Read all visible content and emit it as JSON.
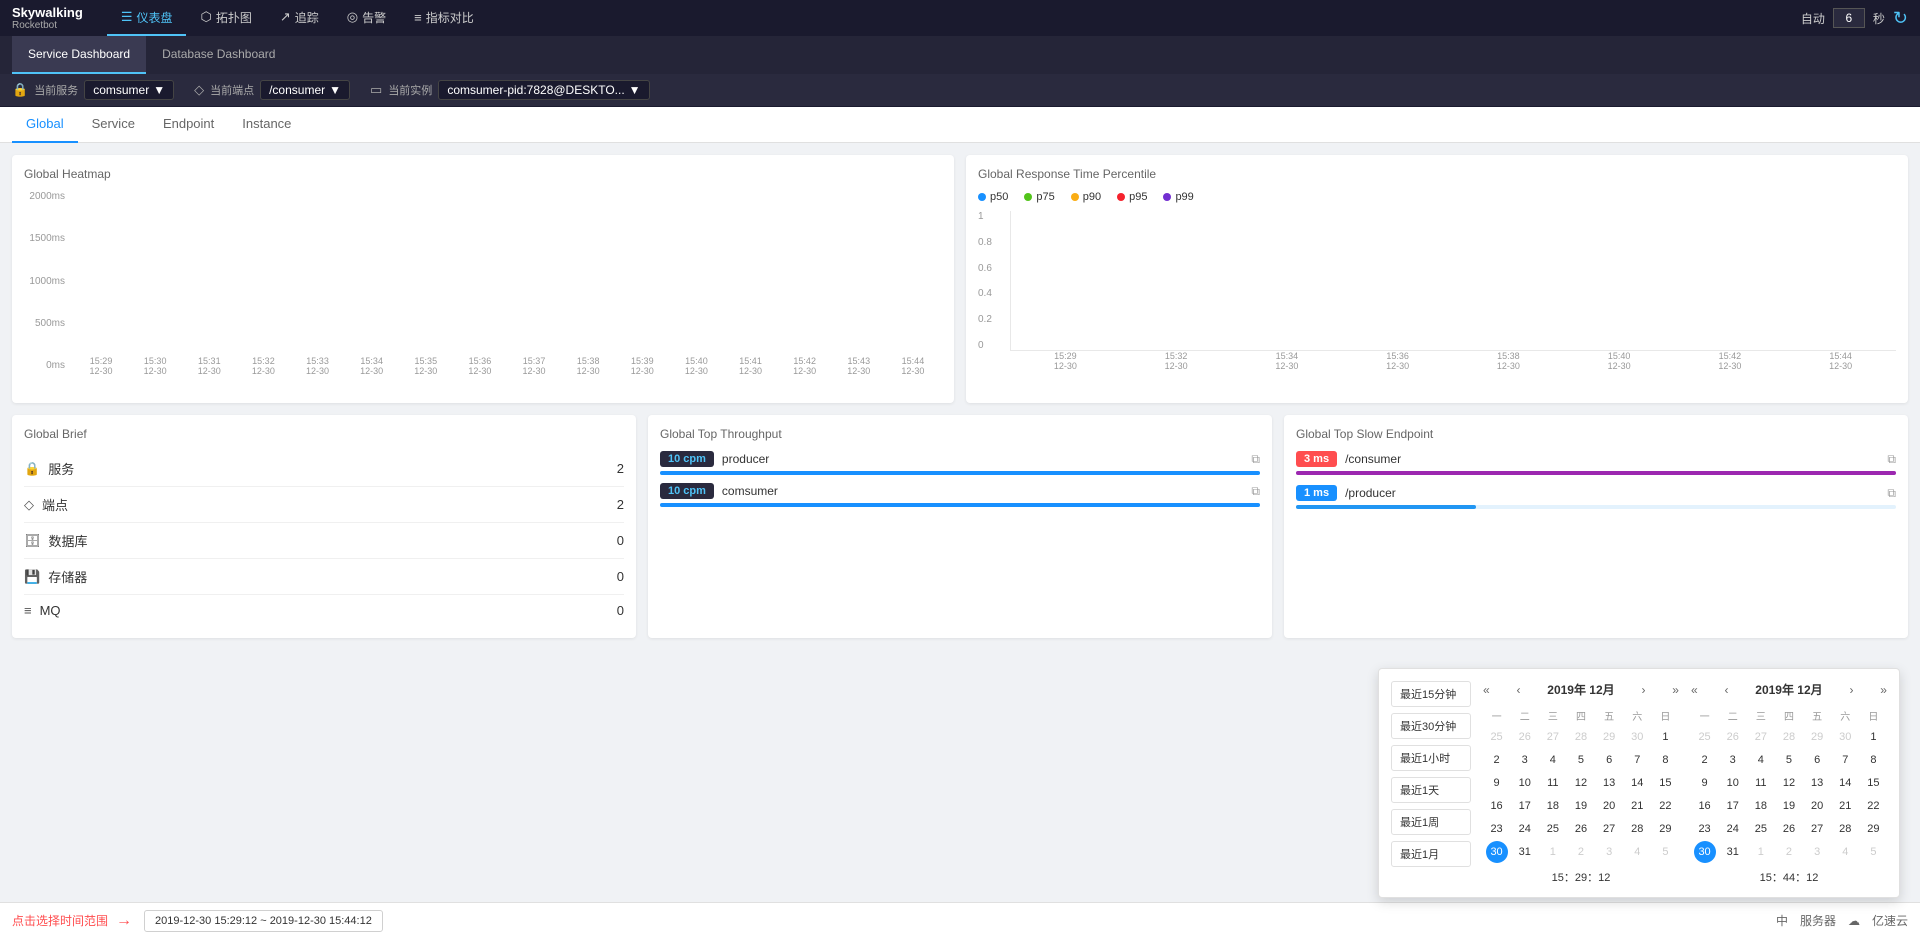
{
  "brand": {
    "name": "Skywalking",
    "sub": "Rocketbot"
  },
  "nav": {
    "items": [
      {
        "id": "dashboard",
        "icon": "☰",
        "label": "仪表盘",
        "active": true
      },
      {
        "id": "topology",
        "icon": "⬡",
        "label": "拓扑图",
        "active": false
      },
      {
        "id": "trace",
        "icon": "↗",
        "label": "追踪",
        "active": false
      },
      {
        "id": "alert",
        "icon": "◎",
        "label": "告警",
        "active": false
      },
      {
        "id": "compare",
        "icon": "≡",
        "label": "指标对比",
        "active": false
      }
    ],
    "auto_label": "自动",
    "sec_value": "6",
    "sec_label": "秒",
    "refresh_label": "刷新"
  },
  "tabs": [
    {
      "id": "service",
      "label": "Service Dashboard",
      "active": true
    },
    {
      "id": "database",
      "label": "Database Dashboard",
      "active": false
    }
  ],
  "toolbar": {
    "service_label": "当前服务",
    "service_value": "comsumer",
    "endpoint_label": "当前端点",
    "endpoint_value": "/consumer",
    "instance_label": "当前实例",
    "instance_value": "comsumer-pid:7828@DESKTO..."
  },
  "content_tabs": [
    {
      "id": "global",
      "label": "Global",
      "active": true
    },
    {
      "id": "service",
      "label": "Service",
      "active": false
    },
    {
      "id": "endpoint",
      "label": "Endpoint",
      "active": false
    },
    {
      "id": "instance",
      "label": "Instance",
      "active": false
    }
  ],
  "heatmap": {
    "title": "Global Heatmap",
    "y_labels": [
      "2000ms",
      "1500ms",
      "1000ms",
      "500ms",
      "0ms"
    ],
    "x_labels": [
      "15:29\n12-30",
      "15:30\n12-30",
      "15:31\n12-30",
      "15:32\n12-30",
      "15:33\n12-30",
      "15:34\n12-30",
      "15:35\n12-30",
      "15:36\n12-30",
      "15:37\n12-30",
      "15:38\n12-30",
      "15:39\n12-30",
      "15:40\n12-30",
      "15:41\n12-30",
      "15:42\n12-30",
      "15:43\n12-30",
      "15:44\n12-30"
    ]
  },
  "response_time": {
    "title": "Global Response Time Percentile",
    "legend": [
      {
        "label": "p50",
        "color": "#1890ff"
      },
      {
        "label": "p75",
        "color": "#52c41a"
      },
      {
        "label": "p90",
        "color": "#faad14"
      },
      {
        "label": "p95",
        "color": "#f5222d"
      },
      {
        "label": "p99",
        "color": "#722ed1"
      }
    ],
    "y_labels": [
      "1",
      "0.8",
      "0.6",
      "0.4",
      "0.2",
      "0"
    ]
  },
  "brief": {
    "title": "Global Brief",
    "items": [
      {
        "icon": "🔒",
        "name": "服务",
        "count": "2"
      },
      {
        "icon": "◇",
        "name": "端点",
        "count": "2"
      },
      {
        "icon": "🗄",
        "name": "数据库",
        "count": "0"
      },
      {
        "icon": "💾",
        "name": "存储器",
        "count": "0"
      },
      {
        "icon": "≡",
        "name": "MQ",
        "count": "0"
      }
    ]
  },
  "throughput": {
    "title": "Global Top Throughput",
    "items": [
      {
        "cpm": "10 cpm",
        "name": "producer",
        "bar_width": "100"
      },
      {
        "cpm": "10 cpm",
        "name": "comsumer",
        "bar_width": "100"
      }
    ]
  },
  "slow_endpoint": {
    "title": "Global Top Slow Endpoint",
    "items": [
      {
        "ms": "3 ms",
        "badge_class": "ms-red",
        "name": "/consumer",
        "bar_width": "100",
        "bar_color": "bar-purple",
        "bar_bg": "bar-purple-bg"
      },
      {
        "ms": "1 ms",
        "badge_class": "ms-blue",
        "name": "/producer",
        "bar_width": "30",
        "bar_color": "bar-blue",
        "bar_bg": "bar-blue-bg"
      }
    ]
  },
  "calendar": {
    "quick_ranges": [
      {
        "label": "最近15分钟"
      },
      {
        "label": "最近30分钟"
      },
      {
        "label": "最近1小时"
      },
      {
        "label": "最近1天"
      },
      {
        "label": "最近1周"
      },
      {
        "label": "最近1月"
      }
    ],
    "left_cal": {
      "title": "2019年 12月",
      "day_headers": [
        "一",
        "二",
        "三",
        "四",
        "五",
        "六",
        "日"
      ],
      "weeks": [
        [
          {
            "d": "25",
            "other": true
          },
          {
            "d": "26",
            "other": true
          },
          {
            "d": "27",
            "other": true
          },
          {
            "d": "28",
            "other": true
          },
          {
            "d": "29",
            "other": true
          },
          {
            "d": "30",
            "other": true
          },
          {
            "d": "1",
            "other": false
          }
        ],
        [
          {
            "d": "2",
            "other": false
          },
          {
            "d": "3",
            "other": false
          },
          {
            "d": "4",
            "other": false
          },
          {
            "d": "5",
            "other": false
          },
          {
            "d": "6",
            "other": false
          },
          {
            "d": "7",
            "other": false
          },
          {
            "d": "8",
            "other": false
          }
        ],
        [
          {
            "d": "9",
            "other": false
          },
          {
            "d": "10",
            "other": false
          },
          {
            "d": "11",
            "other": false
          },
          {
            "d": "12",
            "other": false
          },
          {
            "d": "13",
            "other": false
          },
          {
            "d": "14",
            "other": false
          },
          {
            "d": "15",
            "other": false
          }
        ],
        [
          {
            "d": "16",
            "other": false
          },
          {
            "d": "17",
            "other": false
          },
          {
            "d": "18",
            "other": false
          },
          {
            "d": "19",
            "other": false
          },
          {
            "d": "20",
            "other": false
          },
          {
            "d": "21",
            "other": false
          },
          {
            "d": "22",
            "other": false
          }
        ],
        [
          {
            "d": "23",
            "other": false
          },
          {
            "d": "24",
            "other": false
          },
          {
            "d": "25",
            "other": false
          },
          {
            "d": "26",
            "other": false
          },
          {
            "d": "27",
            "other": false
          },
          {
            "d": "28",
            "other": false
          },
          {
            "d": "29",
            "other": false
          }
        ],
        [
          {
            "d": "30",
            "selected": true
          },
          {
            "d": "31",
            "other": false
          },
          {
            "d": "1",
            "other": true
          },
          {
            "d": "2",
            "other": true
          },
          {
            "d": "3",
            "other": true
          },
          {
            "d": "4",
            "other": true
          },
          {
            "d": "5",
            "other": true
          }
        ]
      ],
      "time": "15：29：12"
    },
    "right_cal": {
      "title": "2019年 12月",
      "day_headers": [
        "一",
        "二",
        "三",
        "四",
        "五",
        "六",
        "日"
      ],
      "weeks": [
        [
          {
            "d": "25",
            "other": true
          },
          {
            "d": "26",
            "other": true
          },
          {
            "d": "27",
            "other": true
          },
          {
            "d": "28",
            "other": true
          },
          {
            "d": "29",
            "other": true
          },
          {
            "d": "30",
            "other": true
          },
          {
            "d": "1",
            "other": false
          }
        ],
        [
          {
            "d": "2",
            "other": false
          },
          {
            "d": "3",
            "other": false
          },
          {
            "d": "4",
            "other": false
          },
          {
            "d": "5",
            "other": false
          },
          {
            "d": "6",
            "other": false
          },
          {
            "d": "7",
            "other": false
          },
          {
            "d": "8",
            "other": false
          }
        ],
        [
          {
            "d": "9",
            "other": false
          },
          {
            "d": "10",
            "other": false
          },
          {
            "d": "11",
            "other": false
          },
          {
            "d": "12",
            "other": false
          },
          {
            "d": "13",
            "other": false
          },
          {
            "d": "14",
            "other": false
          },
          {
            "d": "15",
            "other": false
          }
        ],
        [
          {
            "d": "16",
            "other": false
          },
          {
            "d": "17",
            "other": false
          },
          {
            "d": "18",
            "other": false
          },
          {
            "d": "19",
            "other": false
          },
          {
            "d": "20",
            "other": false
          },
          {
            "d": "21",
            "other": false
          },
          {
            "d": "22",
            "other": false
          }
        ],
        [
          {
            "d": "23",
            "other": false
          },
          {
            "d": "24",
            "other": false
          },
          {
            "d": "25",
            "other": false
          },
          {
            "d": "26",
            "other": false
          },
          {
            "d": "27",
            "other": false
          },
          {
            "d": "28",
            "other": false
          },
          {
            "d": "29",
            "other": false
          }
        ],
        [
          {
            "d": "30",
            "selected": true
          },
          {
            "d": "31",
            "other": false
          },
          {
            "d": "1",
            "other": true
          },
          {
            "d": "2",
            "other": true
          },
          {
            "d": "3",
            "other": true
          },
          {
            "d": "4",
            "other": true
          },
          {
            "d": "5",
            "other": true
          }
        ]
      ],
      "time": "15：44：12"
    }
  },
  "bottom_bar": {
    "hint": "点击选择时间范围",
    "time_range": "2019-12-30 15:29:12 ~ 2019-12-30 15:44:12",
    "label_zh": "中",
    "label_service": "服务器"
  }
}
